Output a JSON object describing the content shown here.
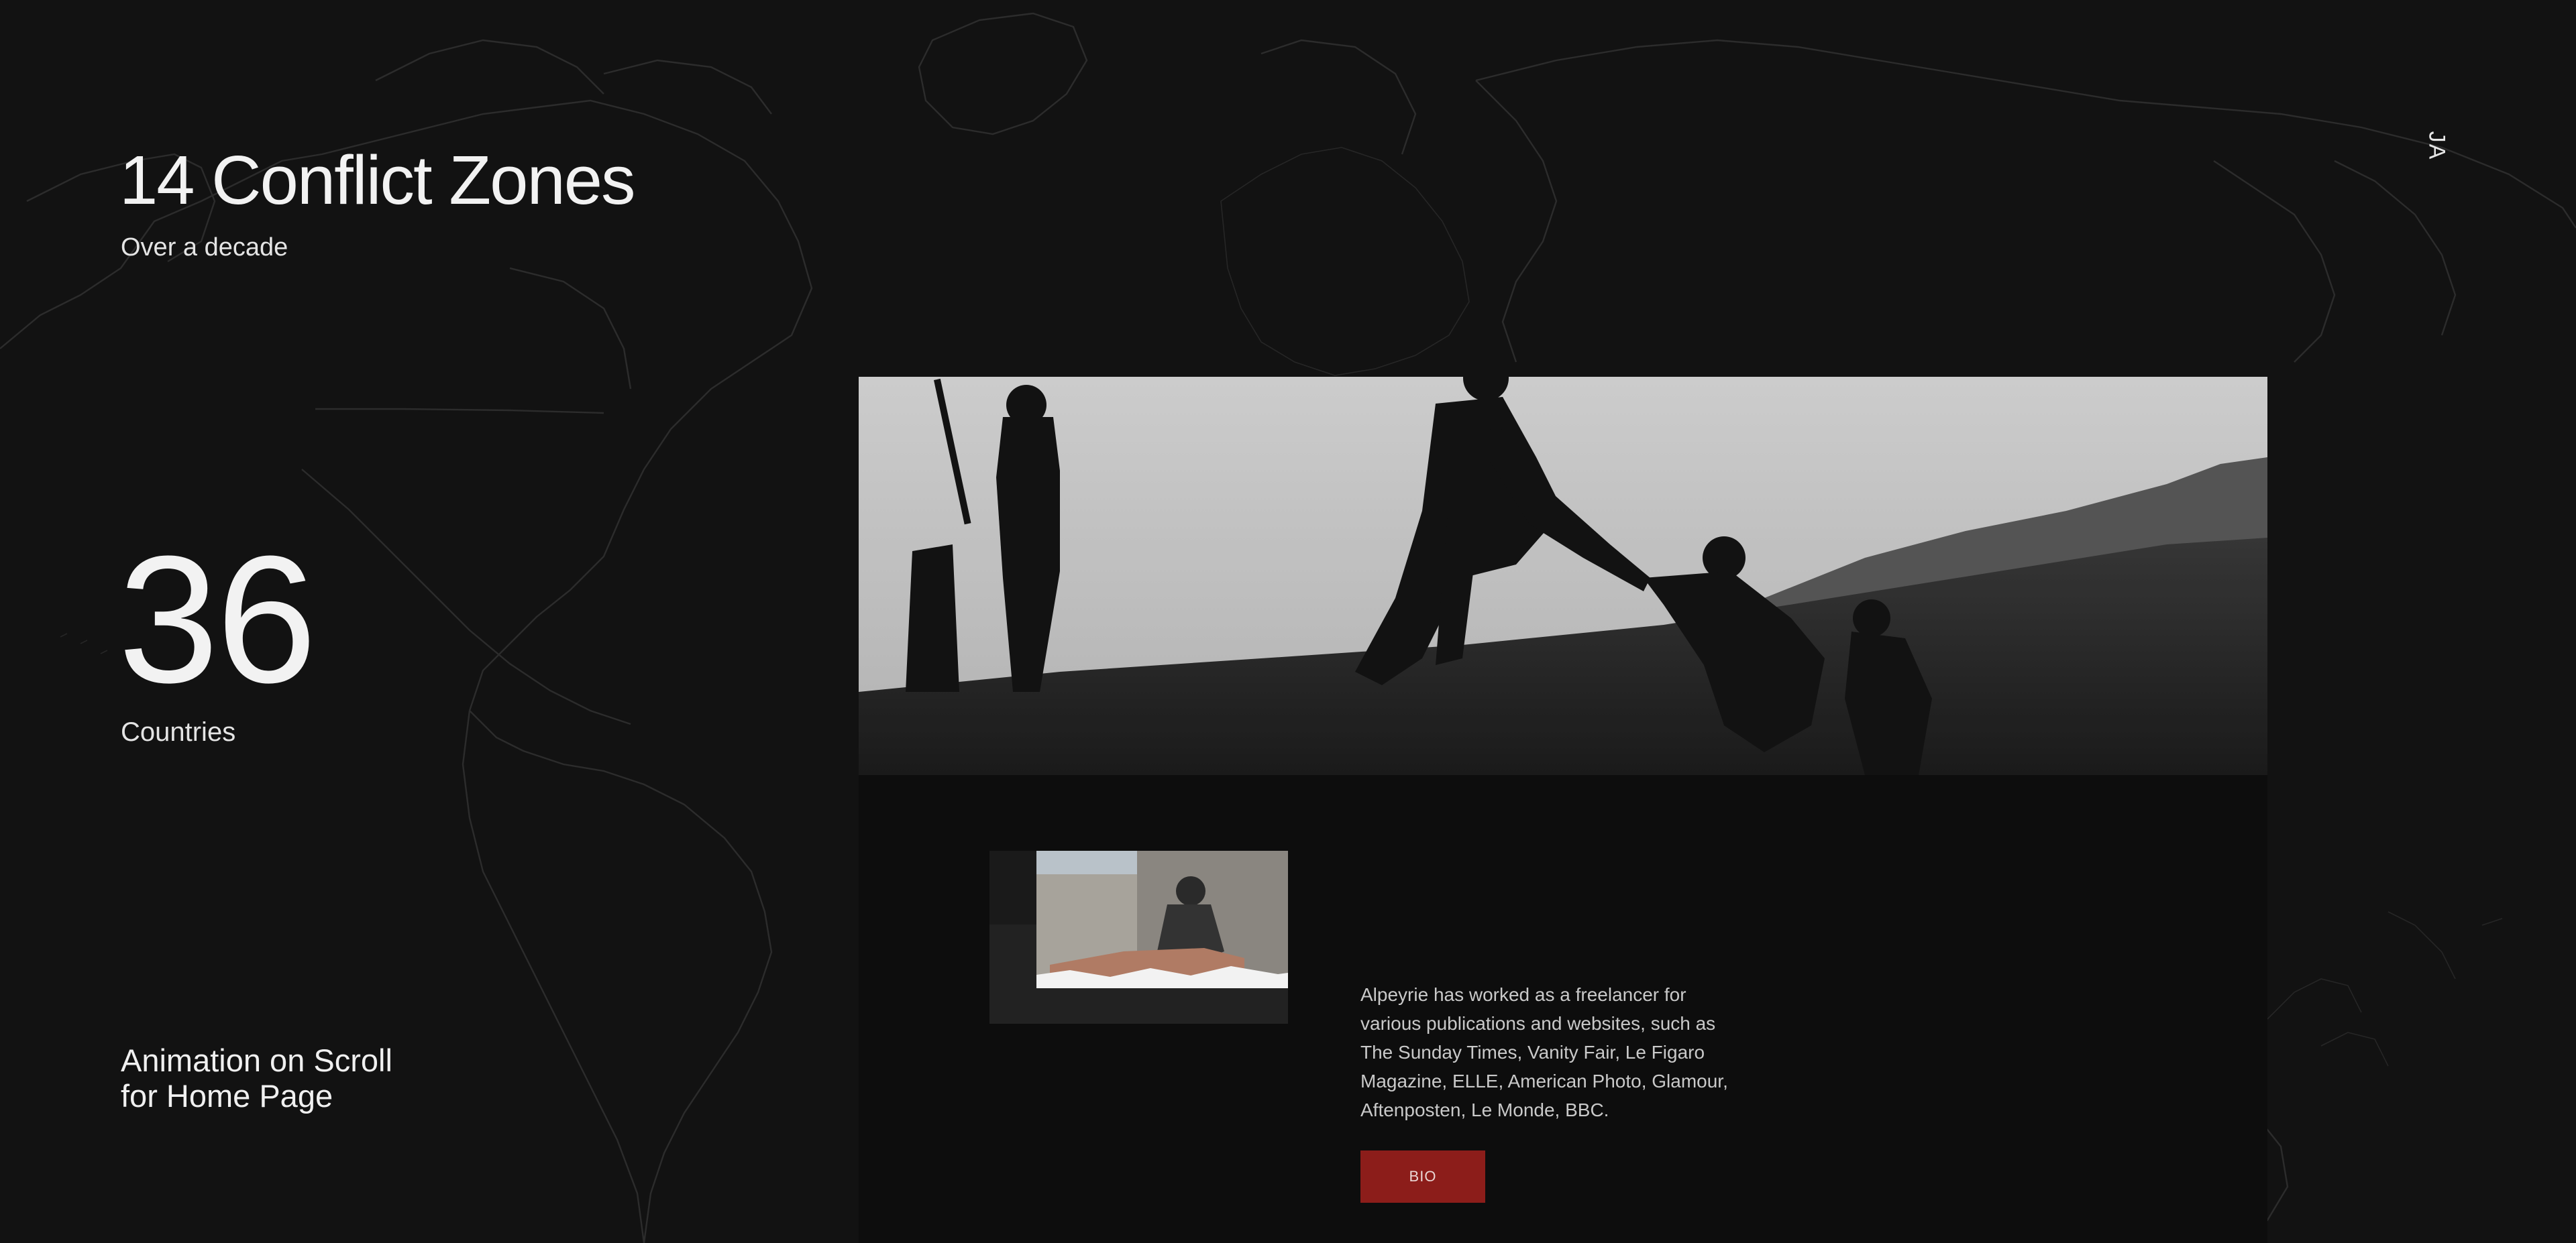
{
  "stats": {
    "conflict_title": "14 Conflict Zones",
    "conflict_sub": "Over a decade",
    "countries_number": "36",
    "countries_label": "Countries"
  },
  "annotation": {
    "line1": "Animation on Scroll",
    "line2": "for Home Page"
  },
  "nav": {
    "language": "JA"
  },
  "bio": {
    "text": "Alpeyrie has worked as a freelancer for various publications and websites, such as The Sunday Times, Vanity Fair, Le Figaro Magazine, ELLE, American Photo, Glamour, Aftenposten, Le Monde, BBC.",
    "button_label": "BIO"
  },
  "colors": {
    "background": "#121212",
    "panel": "#0d0d0d",
    "accent": "#8c1d1a",
    "map_lines": "#2c2c2c"
  }
}
